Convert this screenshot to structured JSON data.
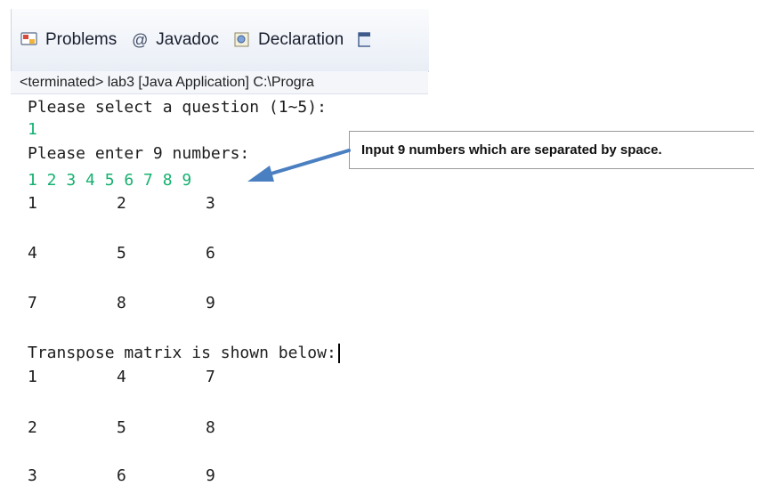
{
  "tabs": [
    {
      "label": "Problems",
      "icon": "problems-icon"
    },
    {
      "label": "Javadoc",
      "icon": "at-icon"
    },
    {
      "label": "Declaration",
      "icon": "declaration-icon"
    }
  ],
  "status": "<terminated> lab3 [Java Application] C:\\Progra",
  "console": {
    "prompt1": "Please select a question (1~5):",
    "answer1": "1",
    "prompt2": "Please enter 9 numbers:",
    "answer2": "1 2 3 4 5 6 7 8 9",
    "matrix": [
      [
        "1",
        "2",
        "3"
      ],
      [
        "4",
        "5",
        "6"
      ],
      [
        "7",
        "8",
        "9"
      ]
    ],
    "transpose_label": "Transpose matrix is shown below:",
    "transpose": [
      [
        "1",
        "4",
        "7"
      ],
      [
        "2",
        "5",
        "8"
      ],
      [
        "3",
        "6",
        "9"
      ]
    ]
  },
  "annotation": "Input 9 numbers which are separated by space.",
  "colors": {
    "input_text": "#15b070",
    "arrow": "#4a7fc1"
  }
}
